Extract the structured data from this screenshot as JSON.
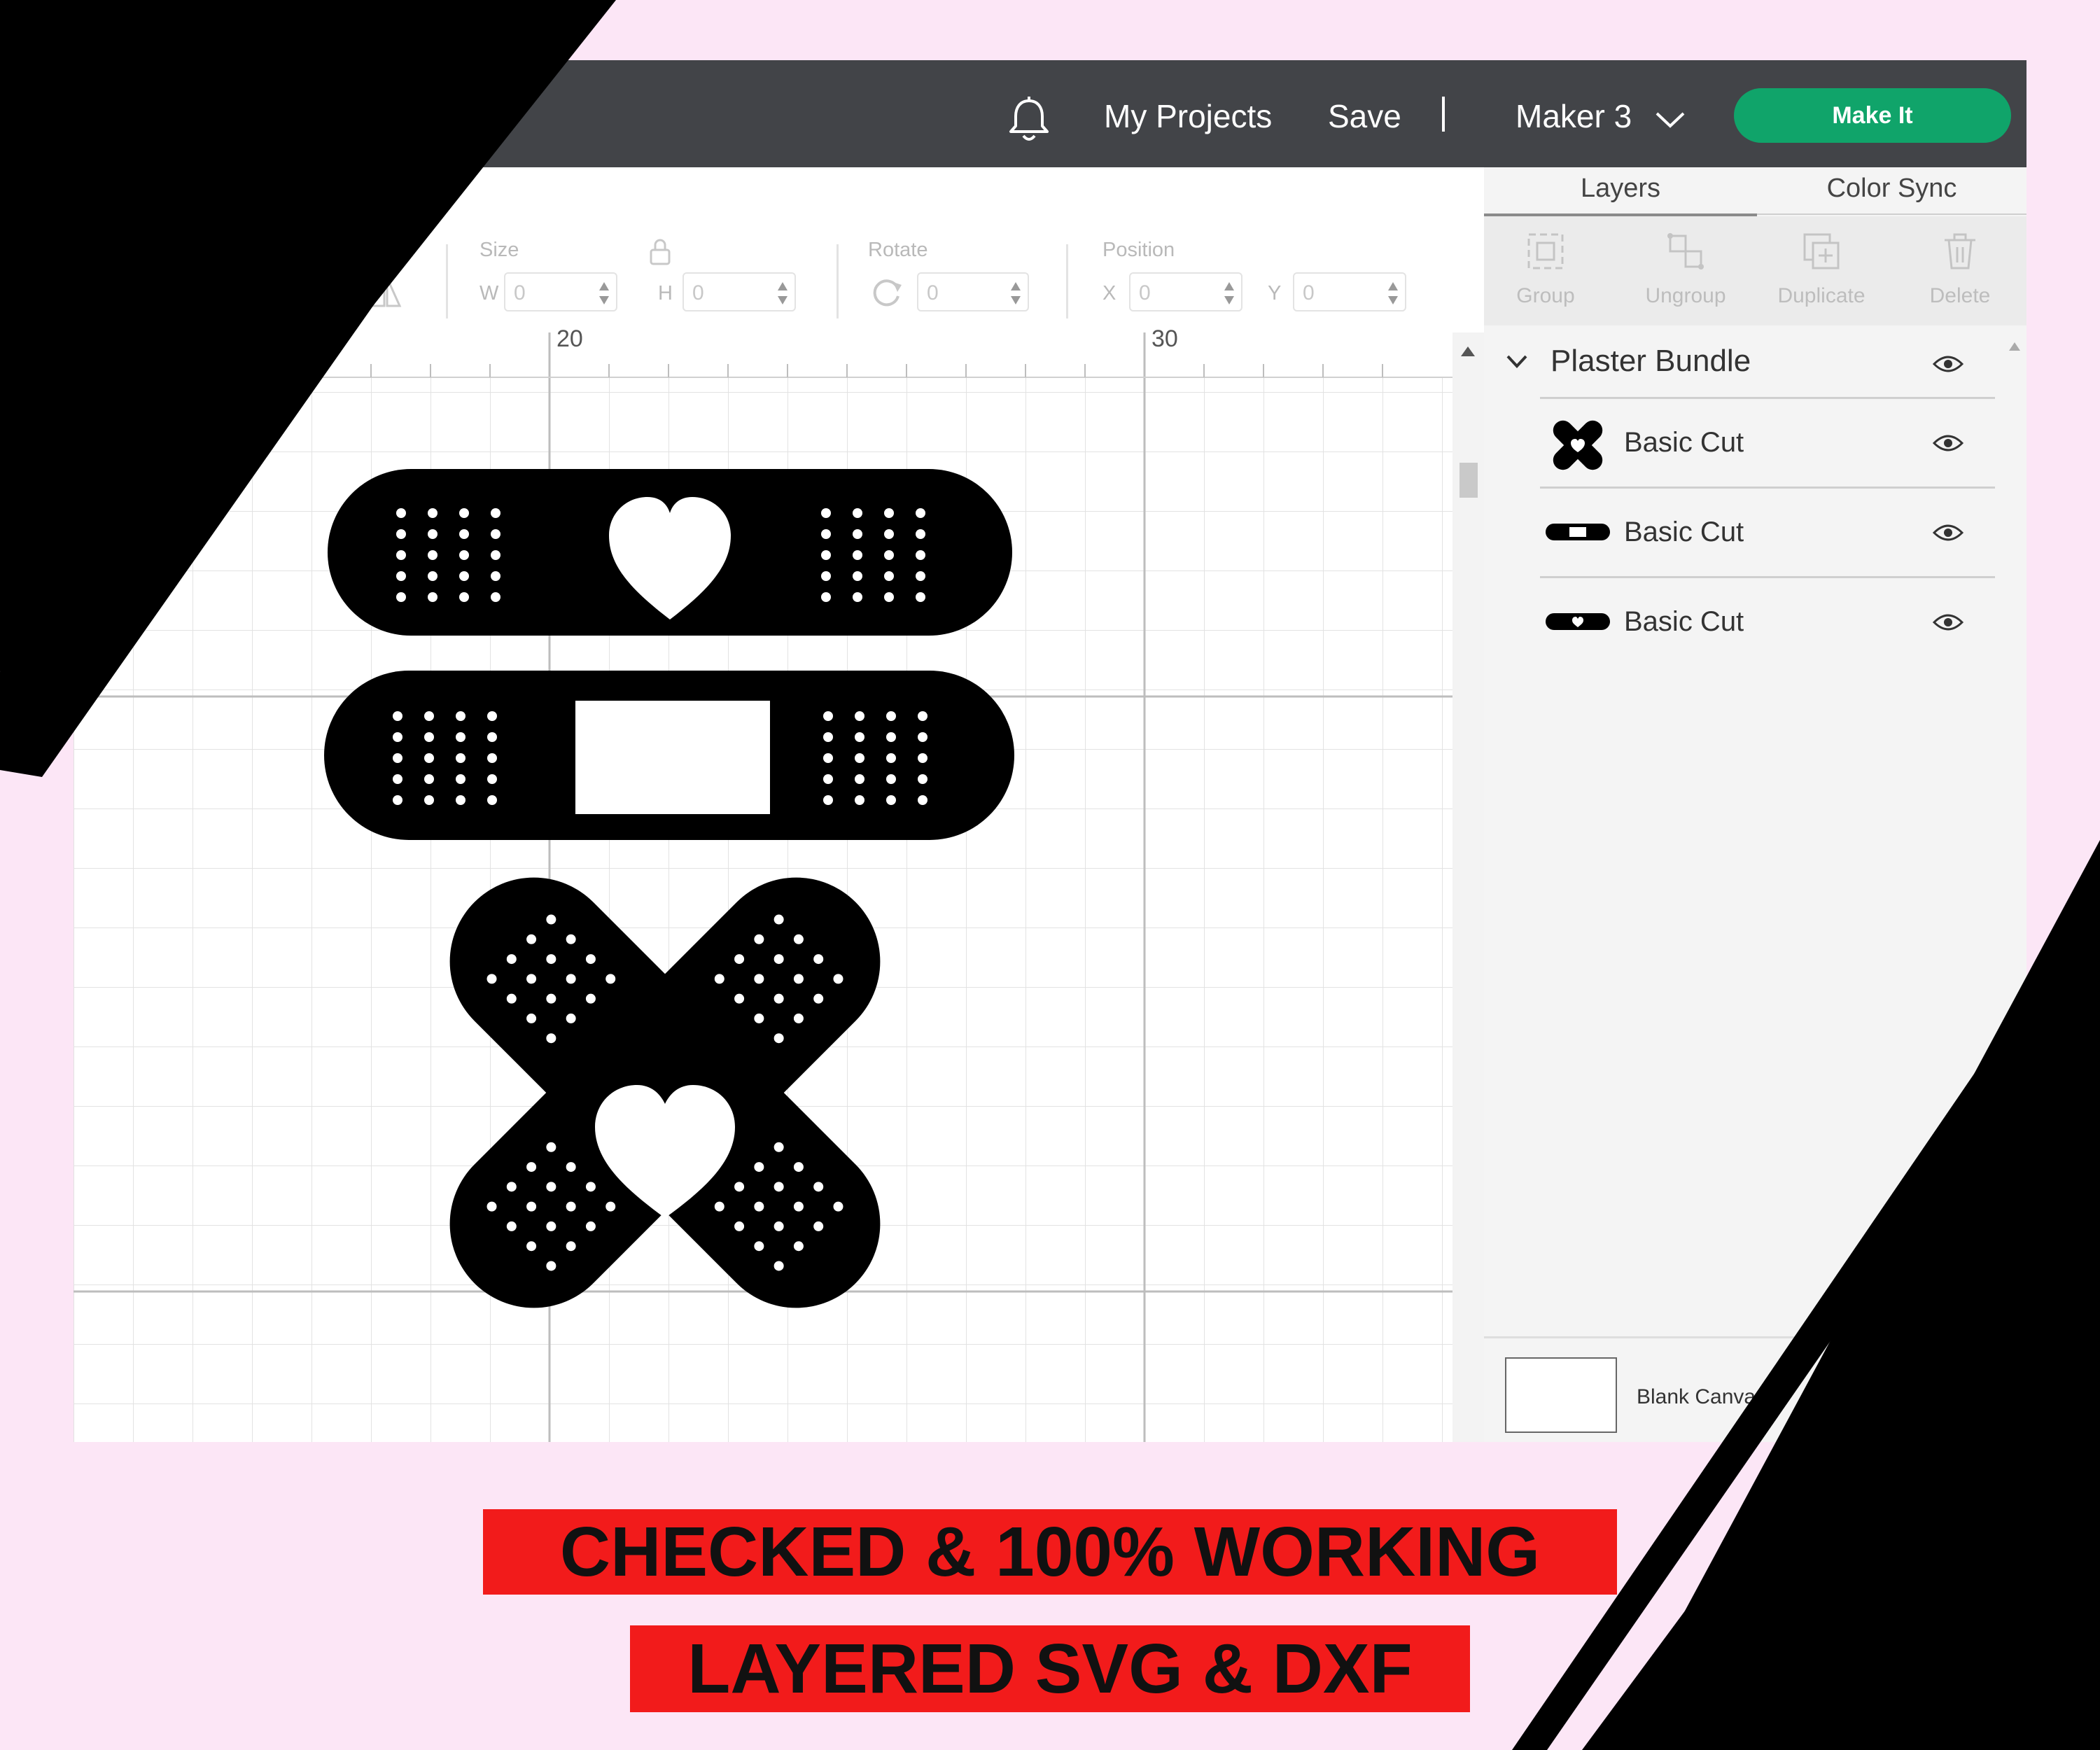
{
  "header": {
    "my_projects": "My Projects",
    "save": "Save",
    "divider": "|",
    "machine": "Maker 3",
    "make_it": "Make It"
  },
  "toolbar": {
    "size_label": "Size",
    "w_label": "W",
    "h_label": "H",
    "w_value": "0",
    "h_value": "0",
    "rotate_label": "Rotate",
    "rotate_value": "0",
    "position_label": "Position",
    "x_label": "X",
    "y_label": "Y",
    "x_value": "0",
    "y_value": "0"
  },
  "ruler": {
    "marks": [
      "20",
      "30"
    ]
  },
  "panel": {
    "tabs": [
      "Layers",
      "Color Sync"
    ],
    "actions": [
      "Group",
      "Ungroup",
      "Duplicate",
      "Delete"
    ],
    "group_name": "Plaster Bundle",
    "layers": [
      {
        "label": "Basic Cut",
        "thumb": "cross-plaster"
      },
      {
        "label": "Basic Cut",
        "thumb": "square-plaster"
      },
      {
        "label": "Basic Cut",
        "thumb": "heart-plaster"
      }
    ],
    "blank_canvas": "Blank Canvas"
  },
  "banners": {
    "line1": "CHECKED & 100% WORKING",
    "line2": "LAYERED SVG & DXF"
  },
  "colors": {
    "topbar": "#424448",
    "make_it": "#10a46a",
    "banner": "#f21b1b",
    "background": "#fce6f6"
  }
}
